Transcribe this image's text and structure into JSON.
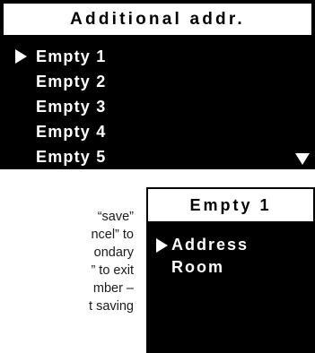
{
  "screen1": {
    "title": "Additional addr.",
    "items": [
      {
        "label": "Empty 1",
        "selected": true
      },
      {
        "label": "Empty 2",
        "selected": false
      },
      {
        "label": "Empty 3",
        "selected": false
      },
      {
        "label": "Empty 4",
        "selected": false
      },
      {
        "label": "Empty 5",
        "selected": false
      }
    ],
    "cursor_icon": "triangle-right-icon",
    "scroll_icon": "triangle-down-icon"
  },
  "description": {
    "lines": [
      "“save”",
      "ncel” to",
      "ondary",
      "” to exit",
      "mber –",
      "t saving"
    ]
  },
  "screen2": {
    "title": "Empty 1",
    "items": [
      {
        "label": "Address",
        "selected": true
      },
      {
        "label": "Room",
        "selected": false
      }
    ],
    "cursor_icon": "triangle-right-icon"
  },
  "colors": {
    "screen_bg": "#000000",
    "screen_text": "#ffffff",
    "title_bg": "#ffffff",
    "title_text": "#000000"
  }
}
